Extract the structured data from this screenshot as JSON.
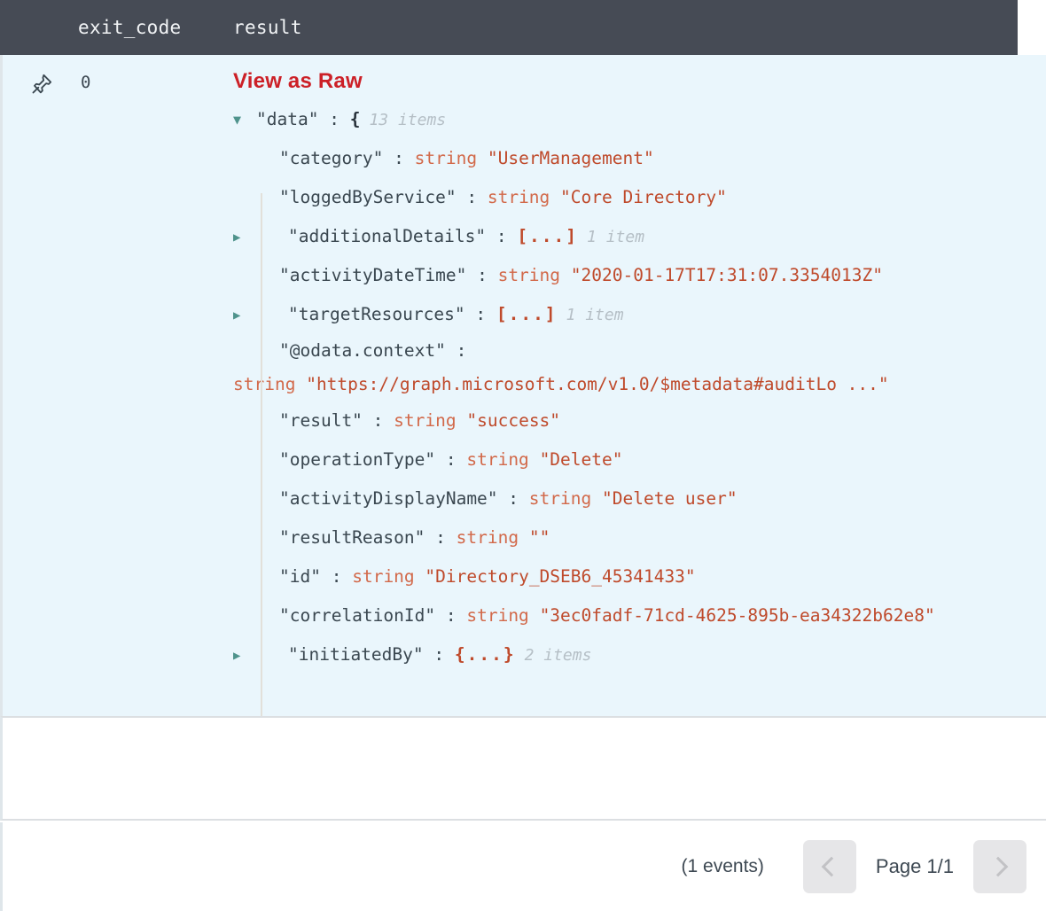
{
  "table": {
    "columns": [
      {
        "key": "pin",
        "label": ""
      },
      {
        "key": "exit_code",
        "label": "exit_code"
      },
      {
        "key": "result",
        "label": "result"
      }
    ]
  },
  "row": {
    "pin_icon": "pushpin-icon",
    "exit_code": "0",
    "raw_link_label": "View as Raw",
    "accent_color": "#cc2027",
    "row_background": "#eaf6fc"
  },
  "json_tree": {
    "root": {
      "twisty": "open",
      "key": "\"data\"",
      "colon": ":",
      "open_brace": "{",
      "count": "13 items",
      "closing_brace": "}"
    },
    "lines": [
      {
        "twisty": "blank",
        "indent": 1,
        "key": "\"category\"",
        "colon": ":",
        "type": "string",
        "value": "\"UserManagement\"",
        "count": ""
      },
      {
        "twisty": "blank",
        "indent": 1,
        "key": "\"loggedByService\"",
        "colon": ":",
        "type": "string",
        "value": "\"Core Directory\"",
        "count": ""
      },
      {
        "twisty": "closed",
        "indent": 2,
        "key": "\"additionalDetails\"",
        "colon": ":",
        "type": "",
        "value": "[...]",
        "count": "1 item"
      },
      {
        "twisty": "blank",
        "indent": 1,
        "key": "\"activityDateTime\"",
        "colon": ":",
        "type": "string",
        "value": "\"2020-01-17T17:31:07.3354013Z\"",
        "count": ""
      },
      {
        "twisty": "closed",
        "indent": 2,
        "key": "\"targetResources\"",
        "colon": ":",
        "type": "",
        "value": "[...]",
        "count": "1 item"
      },
      {
        "twisty": "blank",
        "indent": 1,
        "key": "\"@odata.context\"",
        "colon": ":",
        "type": "string",
        "value": "\"https://graph.microsoft.com/v1.0/$metadata#auditLo ...\"",
        "count": "",
        "wrap": true
      },
      {
        "twisty": "blank",
        "indent": 1,
        "key": "\"result\"",
        "colon": ":",
        "type": "string",
        "value": "\"success\"",
        "count": ""
      },
      {
        "twisty": "blank",
        "indent": 1,
        "key": "\"operationType\"",
        "colon": ":",
        "type": "string",
        "value": "\"Delete\"",
        "count": ""
      },
      {
        "twisty": "blank",
        "indent": 1,
        "key": "\"activityDisplayName\"",
        "colon": ":",
        "type": "string",
        "value": "\"Delete user\"",
        "count": ""
      },
      {
        "twisty": "blank",
        "indent": 1,
        "key": "\"resultReason\"",
        "colon": ":",
        "type": "string",
        "value": "\"\"",
        "count": ""
      },
      {
        "twisty": "blank",
        "indent": 1,
        "key": "\"id\"",
        "colon": ":",
        "type": "string",
        "value": "\"Directory_DSEB6_45341433\"",
        "count": ""
      },
      {
        "twisty": "blank",
        "indent": 1,
        "key": "\"correlationId\"",
        "colon": ":",
        "type": "string",
        "value": "\"3ec0fadf-71cd-4625-895b-ea34322b62e8\"",
        "count": ""
      },
      {
        "twisty": "closed",
        "indent": 2,
        "key": "\"initiatedBy\"",
        "colon": ":",
        "type": "",
        "value": "{...}",
        "count": "2 items"
      }
    ]
  },
  "footer": {
    "events_count": "(1 events)",
    "prev_icon": "chevron-left-icon",
    "page_label": "Page 1/1",
    "next_icon": "chevron-right-icon"
  }
}
